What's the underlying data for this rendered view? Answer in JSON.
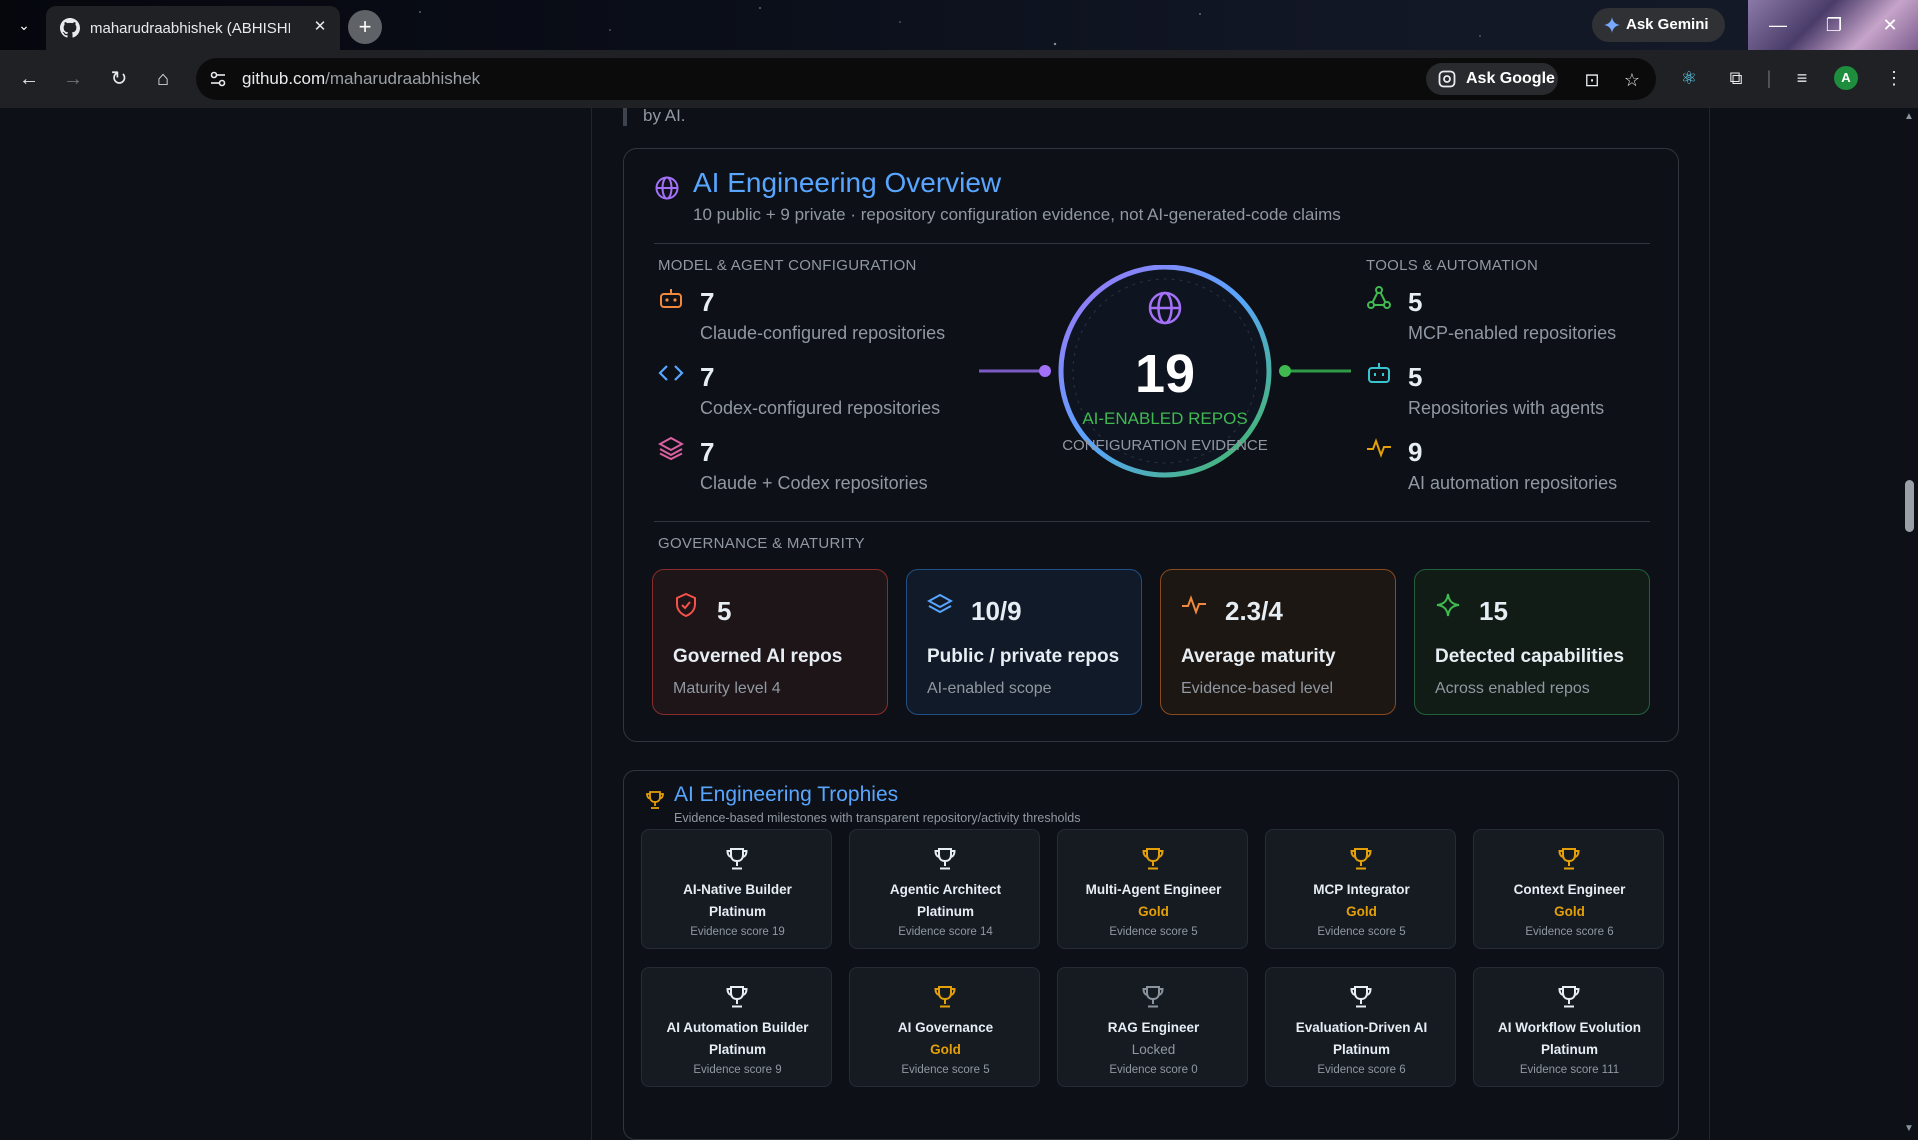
{
  "browser": {
    "tab_title": "maharudraabhishek (ABHISHEK",
    "new_tab_symbol": "+",
    "ask_gemini_label": "Ask Gemini",
    "url_host": "github.com",
    "url_path": "/maharudraabhishek",
    "ask_google_label": "Ask Google",
    "profile_initial": "A"
  },
  "page": {
    "quote_fragment": "by AI."
  },
  "overview": {
    "title": "AI Engineering Overview",
    "subtitle": "10 public + 9 private · repository configuration evidence, not AI-generated-code claims",
    "model_section_label": "MODEL & AGENT CONFIGURATION",
    "tools_section_label": "TOOLS & AUTOMATION",
    "governance_section_label": "GOVERNANCE & MATURITY",
    "model_metrics": [
      {
        "value": "7",
        "label": "Claude-configured repositories",
        "icon": "robot-icon"
      },
      {
        "value": "7",
        "label": "Codex-configured repositories",
        "icon": "code-icon"
      },
      {
        "value": "7",
        "label": "Claude + Codex repositories",
        "icon": "layers-icon"
      }
    ],
    "tool_metrics": [
      {
        "value": "5",
        "label": "MCP-enabled repositories",
        "icon": "graph-icon"
      },
      {
        "value": "5",
        "label": "Repositories with agents",
        "icon": "bot-icon"
      },
      {
        "value": "9",
        "label": "AI automation repositories",
        "icon": "pulse-icon"
      }
    ],
    "hub": {
      "count": "19",
      "label": "AI-ENABLED REPOS",
      "sublabel": "CONFIGURATION EVIDENCE"
    },
    "cards": [
      {
        "value": "5",
        "title": "Governed AI repos",
        "subtitle": "Maturity level 4",
        "icon": "shield-check-icon",
        "accent": "#f85149"
      },
      {
        "value": "10/9",
        "title": "Public / private repos",
        "subtitle": "AI-enabled scope",
        "icon": "layers-icon",
        "accent": "#58a6ff"
      },
      {
        "value": "2.3/4",
        "title": "Average maturity",
        "subtitle": "Evidence-based level",
        "icon": "pulse-icon",
        "accent": "#f0883e"
      },
      {
        "value": "15",
        "title": "Detected capabilities",
        "subtitle": "Across enabled repos",
        "icon": "sparkle-icon",
        "accent": "#3fb950"
      }
    ]
  },
  "trophies": {
    "title": "AI Engineering Trophies",
    "subtitle": "Evidence-based milestones with transparent repository/activity thresholds",
    "items": [
      {
        "name": "AI-Native Builder",
        "tier": "Platinum",
        "score": "Evidence score 19"
      },
      {
        "name": "Agentic Architect",
        "tier": "Platinum",
        "score": "Evidence score 14"
      },
      {
        "name": "Multi-Agent Engineer",
        "tier": "Gold",
        "score": "Evidence score 5"
      },
      {
        "name": "MCP Integrator",
        "tier": "Gold",
        "score": "Evidence score 5"
      },
      {
        "name": "Context Engineer",
        "tier": "Gold",
        "score": "Evidence score 6"
      },
      {
        "name": "AI Automation Builder",
        "tier": "Platinum",
        "score": "Evidence score 9"
      },
      {
        "name": "AI Governance",
        "tier": "Gold",
        "score": "Evidence score 5"
      },
      {
        "name": "RAG Engineer",
        "tier": "Locked",
        "score": "Evidence score 0"
      },
      {
        "name": "Evaluation-Driven AI",
        "tier": "Platinum",
        "score": "Evidence score 6"
      },
      {
        "name": "AI Workflow Evolution",
        "tier": "Platinum",
        "score": "Evidence score 111"
      }
    ]
  },
  "colors": {
    "accent_blue": "#58a6ff",
    "accent_green": "#3fb950",
    "accent_purple": "#a371f7",
    "gold": "#e3a008",
    "platinum": "#e6edf3"
  }
}
